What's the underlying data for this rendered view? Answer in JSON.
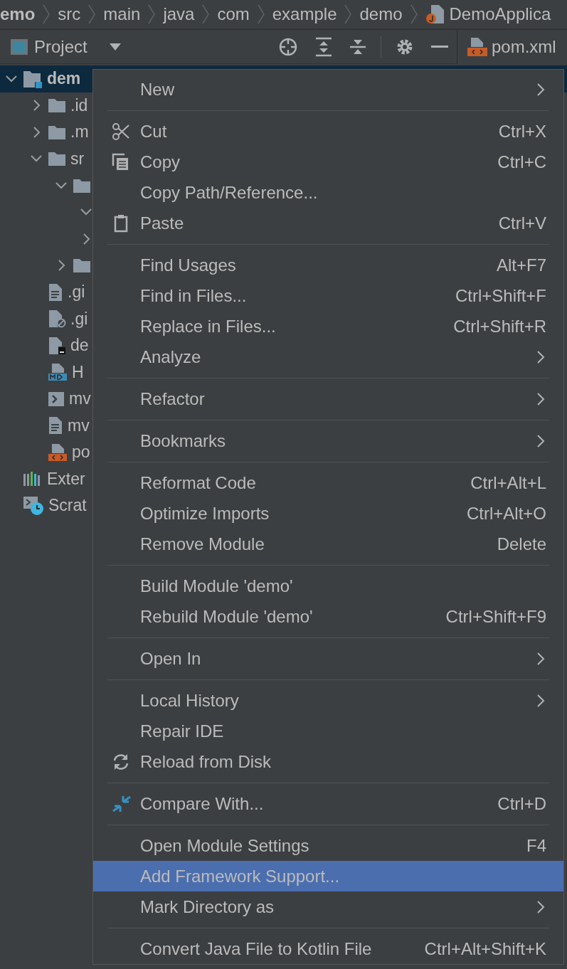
{
  "breadcrumbs": [
    {
      "label": "emo",
      "bold": true,
      "kind": "folder"
    },
    {
      "label": "src",
      "bold": false,
      "kind": "folder"
    },
    {
      "label": "main",
      "bold": false,
      "kind": "folder"
    },
    {
      "label": "java",
      "bold": false,
      "kind": "folder"
    },
    {
      "label": "com",
      "bold": false,
      "kind": "folder"
    },
    {
      "label": "example",
      "bold": false,
      "kind": "folder"
    },
    {
      "label": "demo",
      "bold": false,
      "kind": "folder"
    },
    {
      "label": "DemoApplica",
      "bold": false,
      "kind": "class"
    }
  ],
  "toolbar": {
    "title": "Project",
    "tab": {
      "label": "pom.xml",
      "selected": true
    }
  },
  "tree": [
    {
      "label": "dem",
      "kind": "module",
      "expanded": true,
      "selected": true,
      "children": [
        {
          "label": ".id",
          "kind": "folder",
          "expanded": false,
          "selected": false
        },
        {
          "label": ".m",
          "kind": "folder",
          "expanded": false,
          "selected": false
        },
        {
          "label": "sr",
          "kind": "folder",
          "expanded": true,
          "selected": false,
          "children": [
            {
              "kind": "folder",
              "expanded": true,
              "selected": false,
              "children": [
                {
                  "expanded": true,
                  "selected": false
                },
                {
                  "expanded": false,
                  "selected": false
                }
              ]
            },
            {
              "kind": "folder",
              "expanded": false,
              "selected": false
            }
          ]
        },
        {
          "label": ".gi",
          "kind": "text",
          "selected": false
        },
        {
          "label": ".gi",
          "kind": "ignore",
          "selected": false
        },
        {
          "label": "de",
          "kind": "terminal",
          "selected": false
        },
        {
          "label": "H",
          "kind": "markdown",
          "selected": false
        },
        {
          "label": "mv",
          "kind": "shell",
          "selected": false
        },
        {
          "label": "mv",
          "kind": "text",
          "selected": false
        },
        {
          "label": "po",
          "kind": "xml",
          "selected": false
        }
      ]
    },
    {
      "label": "Exter",
      "kind": "libraries",
      "selected": false
    },
    {
      "label": "Scrat",
      "kind": "scratch",
      "selected": false
    }
  ],
  "menu": {
    "items": [
      {
        "kind": "item",
        "label": "New",
        "submenu": true,
        "selected": false
      },
      {
        "kind": "separator"
      },
      {
        "kind": "item",
        "label": "Cut",
        "shortcut": "Ctrl+X",
        "selected": false
      },
      {
        "kind": "item",
        "label": "Copy",
        "shortcut": "Ctrl+C",
        "selected": false
      },
      {
        "kind": "item",
        "label": "Copy Path/Reference...",
        "selected": false
      },
      {
        "kind": "item",
        "label": "Paste",
        "shortcut": "Ctrl+V",
        "selected": false
      },
      {
        "kind": "separator"
      },
      {
        "kind": "item",
        "label": "Find Usages",
        "shortcut": "Alt+F7",
        "selected": false
      },
      {
        "kind": "item",
        "label": "Find in Files...",
        "shortcut": "Ctrl+Shift+F",
        "selected": false
      },
      {
        "kind": "item",
        "label": "Replace in Files...",
        "shortcut": "Ctrl+Shift+R",
        "selected": false
      },
      {
        "kind": "item",
        "label": "Analyze",
        "submenu": true,
        "selected": false
      },
      {
        "kind": "separator"
      },
      {
        "kind": "item",
        "label": "Refactor",
        "submenu": true,
        "selected": false
      },
      {
        "kind": "separator"
      },
      {
        "kind": "item",
        "label": "Bookmarks",
        "submenu": true,
        "selected": false
      },
      {
        "kind": "separator"
      },
      {
        "kind": "item",
        "label": "Reformat Code",
        "shortcut": "Ctrl+Alt+L",
        "selected": false
      },
      {
        "kind": "item",
        "label": "Optimize Imports",
        "shortcut": "Ctrl+Alt+O",
        "selected": false
      },
      {
        "kind": "item",
        "label": "Remove Module",
        "shortcut": "Delete",
        "selected": false
      },
      {
        "kind": "separator"
      },
      {
        "kind": "item",
        "label": "Build Module 'demo'",
        "selected": false
      },
      {
        "kind": "item",
        "label": "Rebuild Module 'demo'",
        "shortcut": "Ctrl+Shift+F9",
        "selected": false
      },
      {
        "kind": "separator"
      },
      {
        "kind": "item",
        "label": "Open In",
        "submenu": true,
        "selected": false
      },
      {
        "kind": "separator"
      },
      {
        "kind": "item",
        "label": "Local History",
        "submenu": true,
        "selected": false
      },
      {
        "kind": "item",
        "label": "Repair IDE",
        "selected": false
      },
      {
        "kind": "item",
        "label": "Reload from Disk",
        "selected": false
      },
      {
        "kind": "separator"
      },
      {
        "kind": "item",
        "label": "Compare With...",
        "shortcut": "Ctrl+D",
        "selected": false
      },
      {
        "kind": "separator"
      },
      {
        "kind": "item",
        "label": "Open Module Settings",
        "shortcut": "F4",
        "selected": false
      },
      {
        "kind": "item",
        "label": "Add Framework Support...",
        "selected": true
      },
      {
        "kind": "item",
        "label": "Mark Directory as",
        "submenu": true,
        "selected": false
      },
      {
        "kind": "separator"
      },
      {
        "kind": "item",
        "label": "Convert Java File to Kotlin File",
        "shortcut": "Ctrl+Alt+Shift+K",
        "selected": false
      }
    ]
  }
}
